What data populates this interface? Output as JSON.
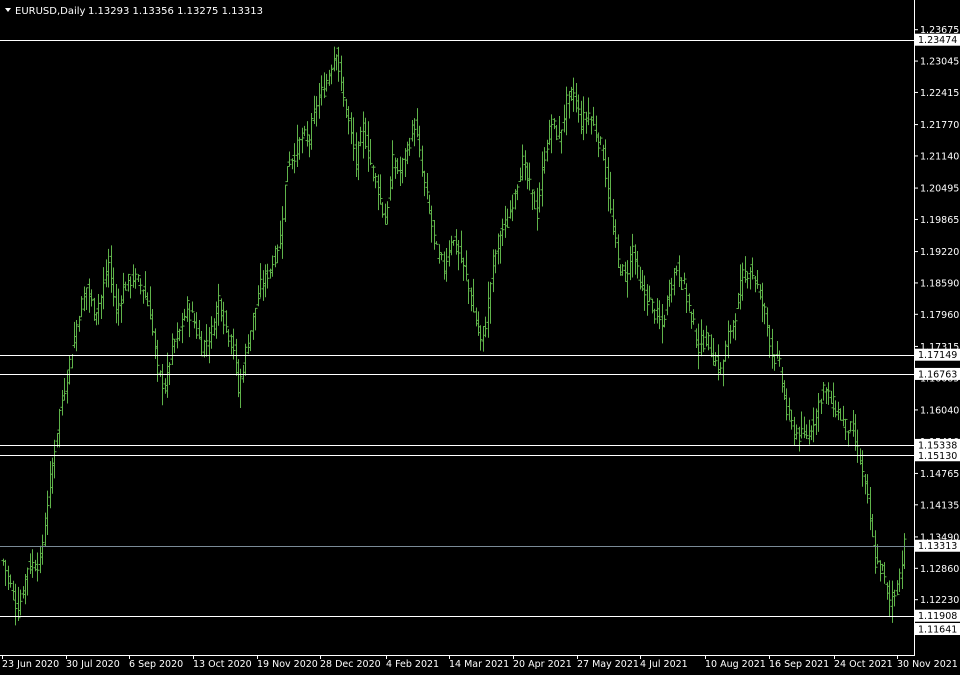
{
  "header": {
    "symbol_timeframe": "EURUSD,Daily",
    "ohlc": "1.13293 1.13356 1.13275 1.13313"
  },
  "colors": {
    "background": "#000000",
    "candle": "#5fb34a",
    "axis": "#ffffff",
    "level_line": "#ffffff",
    "current_price_line": "#7a8a96",
    "label_bg": "#ffffff"
  },
  "chart_data": {
    "type": "ohlc",
    "symbol": "EURUSD",
    "timeframe": "Daily",
    "ylim": [
      1.1132,
      1.2395
    ],
    "yticks": [
      1.23675,
      1.23045,
      1.22415,
      1.2177,
      1.2114,
      1.20495,
      1.19865,
      1.1922,
      1.1859,
      1.1796,
      1.17315,
      1.16685,
      1.1604,
      1.1541,
      1.14765,
      1.14135,
      1.1349,
      1.1286,
      1.1223,
      1.116
    ],
    "ytick_labels": [
      "1.23675",
      "1.23045",
      "1.22415",
      "1.21770",
      "1.21140",
      "1.20495",
      "1.19865",
      "1.19220",
      "1.18590",
      "1.17960",
      "1.17315",
      "1.16685",
      "1.16040",
      "1.15410",
      "1.14765",
      "1.14135",
      "1.13490",
      "1.12860",
      "1.12230",
      "1.11600"
    ],
    "xticks": [
      "23 Jun 2020",
      "30 Jul 2020",
      "6 Sep 2020",
      "13 Oct 2020",
      "19 Nov 2020",
      "28 Dec 2020",
      "4 Feb 2021",
      "14 Mar 2021",
      "20 Apr 2021",
      "27 May 2021",
      "4 Jul 2021",
      "10 Aug 2021",
      "16 Sep 2021",
      "24 Oct 2021",
      "30 Nov 2021"
    ],
    "levels": [
      {
        "value": 1.23474,
        "label": "1.23474"
      },
      {
        "value": 1.17149,
        "label": "1.17149"
      },
      {
        "value": 1.16763,
        "label": "1.16763"
      },
      {
        "value": 1.15338,
        "label": "1.15338"
      },
      {
        "value": 1.1513,
        "label": "1.15130"
      },
      {
        "value": 1.11908,
        "label": "1.11908"
      }
    ],
    "current_price": {
      "value": 1.13313,
      "label": "1.13313"
    },
    "bottom_label": {
      "value": 1.11641,
      "label": "1.11641"
    },
    "close_path": [
      [
        0,
        1.13
      ],
      [
        6,
        1.12
      ],
      [
        10,
        1.129
      ],
      [
        15,
        1.13
      ],
      [
        19,
        1.146
      ],
      [
        23,
        1.16
      ],
      [
        27,
        1.17
      ],
      [
        31,
        1.18
      ],
      [
        34,
        1.185
      ],
      [
        37,
        1.18
      ],
      [
        40,
        1.183
      ],
      [
        43,
        1.19
      ],
      [
        46,
        1.18
      ],
      [
        49,
        1.185
      ],
      [
        53,
        1.187
      ],
      [
        57,
        1.185
      ],
      [
        60,
        1.18
      ],
      [
        63,
        1.168
      ],
      [
        66,
        1.165
      ],
      [
        69,
        1.173
      ],
      [
        72,
        1.176
      ],
      [
        75,
        1.181
      ],
      [
        78,
        1.178
      ],
      [
        81,
        1.173
      ],
      [
        85,
        1.176
      ],
      [
        88,
        1.183
      ],
      [
        91,
        1.177
      ],
      [
        94,
        1.173
      ],
      [
        96,
        1.164
      ],
      [
        99,
        1.172
      ],
      [
        102,
        1.179
      ],
      [
        105,
        1.185
      ],
      [
        108,
        1.188
      ],
      [
        110,
        1.19
      ],
      [
        113,
        1.195
      ],
      [
        116,
        1.21
      ],
      [
        119,
        1.212
      ],
      [
        122,
        1.215
      ],
      [
        125,
        1.215
      ],
      [
        128,
        1.222
      ],
      [
        131,
        1.225
      ],
      [
        134,
        1.23
      ],
      [
        136,
        1.233
      ],
      [
        138,
        1.225
      ],
      [
        141,
        1.218
      ],
      [
        144,
        1.21
      ],
      [
        147,
        1.217
      ],
      [
        150,
        1.21
      ],
      [
        153,
        1.205
      ],
      [
        156,
        1.198
      ],
      [
        159,
        1.21
      ],
      [
        162,
        1.208
      ],
      [
        165,
        1.213
      ],
      [
        168,
        1.218
      ],
      [
        171,
        1.208
      ],
      [
        174,
        1.2
      ],
      [
        177,
        1.192
      ],
      [
        180,
        1.189
      ],
      [
        183,
        1.195
      ],
      [
        186,
        1.192
      ],
      [
        189,
        1.187
      ],
      [
        192,
        1.18
      ],
      [
        195,
        1.174
      ],
      [
        197,
        1.178
      ],
      [
        200,
        1.19
      ],
      [
        203,
        1.196
      ],
      [
        206,
        1.198
      ],
      [
        209,
        1.205
      ],
      [
        212,
        1.21
      ],
      [
        215,
        1.205
      ],
      [
        218,
        1.2
      ],
      [
        221,
        1.212
      ],
      [
        224,
        1.218
      ],
      [
        227,
        1.215
      ],
      [
        230,
        1.222
      ],
      [
        233,
        1.224
      ],
      [
        236,
        1.218
      ],
      [
        239,
        1.22
      ],
      [
        242,
        1.216
      ],
      [
        245,
        1.212
      ],
      [
        248,
        1.2
      ],
      [
        251,
        1.19
      ],
      [
        254,
        1.187
      ],
      [
        257,
        1.193
      ],
      [
        260,
        1.185
      ],
      [
        263,
        1.183
      ],
      [
        266,
        1.18
      ],
      [
        269,
        1.177
      ],
      [
        272,
        1.185
      ],
      [
        275,
        1.189
      ],
      [
        278,
        1.185
      ],
      [
        281,
        1.179
      ],
      [
        284,
        1.173
      ],
      [
        287,
        1.175
      ],
      [
        290,
        1.171
      ],
      [
        293,
        1.168
      ],
      [
        296,
        1.175
      ],
      [
        299,
        1.18
      ],
      [
        302,
        1.187
      ],
      [
        305,
        1.189
      ],
      [
        308,
        1.185
      ],
      [
        311,
        1.18
      ],
      [
        314,
        1.172
      ],
      [
        317,
        1.169
      ],
      [
        320,
        1.16
      ],
      [
        323,
        1.156
      ],
      [
        326,
        1.155
      ],
      [
        329,
        1.156
      ],
      [
        332,
        1.16
      ],
      [
        335,
        1.165
      ],
      [
        338,
        1.162
      ],
      [
        341,
        1.16
      ],
      [
        344,
        1.157
      ],
      [
        347,
        1.156
      ],
      [
        350,
        1.15
      ],
      [
        353,
        1.142
      ],
      [
        356,
        1.13
      ],
      [
        359,
        1.128
      ],
      [
        362,
        1.122
      ],
      [
        365,
        1.125
      ],
      [
        368,
        1.133
      ]
    ]
  }
}
